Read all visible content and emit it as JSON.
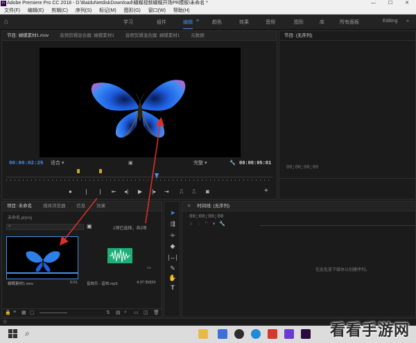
{
  "window": {
    "title": "Adobe Premiere Pro CC 2018 - D:\\BaiduNetdiskDownload\\蝴蝶视频蝴蝶开场PR模板\\未命名 *",
    "controls": [
      "—",
      "☐",
      "✕"
    ]
  },
  "menu": [
    "文件(F)",
    "编辑(E)",
    "剪辑(C)",
    "序列(S)",
    "标记(M)",
    "图形(G)",
    "窗口(W)",
    "帮助(H)"
  ],
  "workspaces": {
    "items": [
      "学习",
      "组件",
      "编辑",
      "颜色",
      "效果",
      "音频",
      "图形",
      "库",
      "所有面板",
      "Editing"
    ],
    "active": "编辑"
  },
  "program": {
    "tabs": [
      "节目: 蝴蝶素材1.mov",
      "音频剪辑混合器: 蝴蝶素材1",
      "音频剪辑混合器: 蝴蝶素材1",
      "元数据"
    ],
    "timecode_current": "00:00:02:25",
    "fit": "适合",
    "quality": "完整",
    "timecode_total": "00:00:05:01"
  },
  "source": {
    "title": "节目: (无序列)",
    "timecode": "00;00;00;00"
  },
  "project": {
    "tabs": [
      "项目: 未命名",
      "媒体浏览器",
      "信息",
      "效果"
    ],
    "file": "未命名.prproj",
    "selection": "1项已选择，共2项",
    "items": [
      {
        "name": "蝴蝶素材1.mov",
        "duration": "5:01"
      },
      {
        "name": "音效乐 - 音效.mp3",
        "duration": "4:37:35820"
      }
    ]
  },
  "timeline": {
    "title": "时间线: (无序列)",
    "timecode": "00;00;00;00",
    "empty_message": "在此处放下媒体以创建序列。"
  },
  "watermark": {
    "text": "看看手游网"
  },
  "taskbar": {
    "search_icon": "search-icon"
  },
  "colors": {
    "accent": "#4a8fe8",
    "panel_bg": "#1b1b1b",
    "arrow": "#d9302a",
    "audio_wave": "#27c08a"
  }
}
